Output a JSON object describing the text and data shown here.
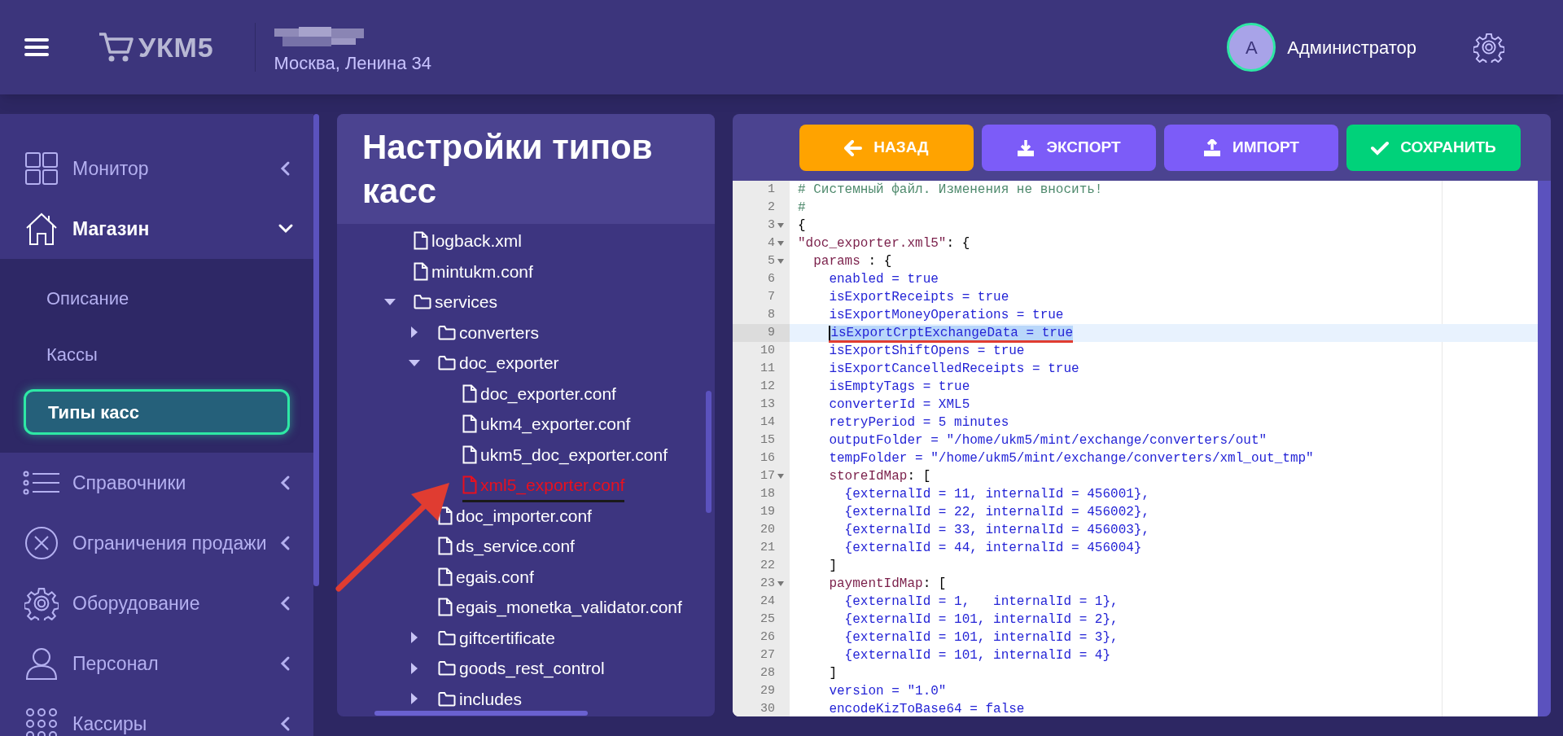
{
  "header": {
    "logo": "УКМ5",
    "address": "Москва, Ленина 34",
    "user": {
      "initial": "А",
      "name": "Администратор"
    }
  },
  "sidebar": {
    "items": [
      {
        "label": "Монитор",
        "expanded": false
      },
      {
        "label": "Магазин",
        "expanded": true,
        "children": [
          {
            "label": "Описание",
            "selected": false
          },
          {
            "label": "Кассы",
            "selected": false
          },
          {
            "label": "Типы касс",
            "selected": true
          }
        ]
      },
      {
        "label": "Справочники",
        "expanded": false
      },
      {
        "label": "Ограничения продажи",
        "expanded": false
      },
      {
        "label": "Оборудование",
        "expanded": false
      },
      {
        "label": "Персонал",
        "expanded": false
      },
      {
        "label": "Кассиры",
        "expanded": false
      }
    ]
  },
  "tree_panel": {
    "title": "Настройки типов касс",
    "tree": [
      {
        "name": "logback.xml",
        "kind": "file",
        "marked": false
      },
      {
        "name": "mintukm.conf",
        "kind": "file",
        "marked": false
      },
      {
        "name": "services",
        "kind": "folder",
        "expanded": true,
        "children": [
          {
            "name": "converters",
            "kind": "folder",
            "expanded": false
          },
          {
            "name": "doc_exporter",
            "kind": "folder",
            "expanded": true,
            "children": [
              {
                "name": "doc_exporter.conf",
                "kind": "file",
                "marked": false
              },
              {
                "name": "ukm4_exporter.conf",
                "kind": "file",
                "marked": false
              },
              {
                "name": "ukm5_doc_exporter.conf",
                "kind": "file",
                "marked": false
              },
              {
                "name": "xml5_exporter.conf",
                "kind": "file",
                "marked": true
              }
            ]
          },
          {
            "name": "doc_importer.conf",
            "kind": "file",
            "marked": false
          },
          {
            "name": "ds_service.conf",
            "kind": "file",
            "marked": false
          },
          {
            "name": "egais.conf",
            "kind": "file",
            "marked": false
          },
          {
            "name": "egais_monetka_validator.conf",
            "kind": "file",
            "marked": false
          },
          {
            "name": "giftcertificate",
            "kind": "folder",
            "expanded": false
          },
          {
            "name": "goods_rest_control",
            "kind": "folder",
            "expanded": false
          },
          {
            "name": "includes",
            "kind": "folder",
            "expanded": false
          }
        ]
      }
    ]
  },
  "editor": {
    "buttons": [
      {
        "label": "НАЗАД",
        "kind": "back"
      },
      {
        "label": "ЭКСПОРТ",
        "kind": "export"
      },
      {
        "label": "ИМПОРТ",
        "kind": "import"
      },
      {
        "label": "СОХРАНИТЬ",
        "kind": "save"
      }
    ],
    "lines": [
      {
        "number": "1",
        "foldable": false,
        "highlighted": false,
        "tokens": [
          {
            "text": "# Системный файл. Изменения не вносить!",
            "kind": "comment"
          }
        ]
      },
      {
        "number": "2",
        "foldable": false,
        "highlighted": false,
        "tokens": [
          {
            "text": "#",
            "kind": "comment"
          }
        ]
      },
      {
        "number": "3",
        "foldable": true,
        "highlighted": false,
        "tokens": [
          {
            "text": "{",
            "kind": "plain"
          }
        ]
      },
      {
        "number": "4",
        "foldable": true,
        "highlighted": false,
        "tokens": [
          {
            "text": "\"doc_exporter.xml5\"",
            "kind": "key"
          },
          {
            "text": ": {",
            "kind": "plain"
          }
        ]
      },
      {
        "number": "5",
        "foldable": true,
        "highlighted": false,
        "tokens": [
          {
            "text": "  params",
            "kind": "key"
          },
          {
            "text": " : {",
            "kind": "plain"
          }
        ]
      },
      {
        "number": "6",
        "foldable": false,
        "highlighted": false,
        "tokens": [
          {
            "text": "    enabled = true",
            "kind": "value"
          }
        ]
      },
      {
        "number": "7",
        "foldable": false,
        "highlighted": false,
        "tokens": [
          {
            "text": "    isExportReceipts = true",
            "kind": "value"
          }
        ]
      },
      {
        "number": "8",
        "foldable": false,
        "highlighted": false,
        "tokens": [
          {
            "text": "    isExportMoneyOperations = true",
            "kind": "value"
          }
        ]
      },
      {
        "number": "9",
        "foldable": false,
        "highlighted": true,
        "tokens": [
          {
            "text": "    isExportCrptExchangeData = true",
            "kind": "value"
          }
        ]
      },
      {
        "number": "10",
        "foldable": false,
        "highlighted": false,
        "tokens": [
          {
            "text": "    isExportShiftOpens = true",
            "kind": "value"
          }
        ]
      },
      {
        "number": "11",
        "foldable": false,
        "highlighted": false,
        "tokens": [
          {
            "text": "    isExportCancelledReceipts = true",
            "kind": "value"
          }
        ]
      },
      {
        "number": "12",
        "foldable": false,
        "highlighted": false,
        "tokens": [
          {
            "text": "    isEmptyTags = true",
            "kind": "value"
          }
        ]
      },
      {
        "number": "13",
        "foldable": false,
        "highlighted": false,
        "tokens": [
          {
            "text": "    converterId = XML5",
            "kind": "value"
          }
        ]
      },
      {
        "number": "14",
        "foldable": false,
        "highlighted": false,
        "tokens": [
          {
            "text": "    retryPeriod = 5 minutes",
            "kind": "value"
          }
        ]
      },
      {
        "number": "15",
        "foldable": false,
        "highlighted": false,
        "tokens": [
          {
            "text": "    outputFolder = \"/home/ukm5/mint/exchange/converters/out\"",
            "kind": "value"
          }
        ]
      },
      {
        "number": "16",
        "foldable": false,
        "highlighted": false,
        "tokens": [
          {
            "text": "    tempFolder = \"/home/ukm5/mint/exchange/converters/xml_out_tmp\"",
            "kind": "value"
          }
        ]
      },
      {
        "number": "17",
        "foldable": true,
        "highlighted": false,
        "tokens": [
          {
            "text": "    storeIdMap",
            "kind": "key"
          },
          {
            "text": ": [",
            "kind": "plain"
          }
        ]
      },
      {
        "number": "18",
        "foldable": false,
        "highlighted": false,
        "tokens": [
          {
            "text": "      {externalId = 11, internalId = 456001},",
            "kind": "value"
          }
        ]
      },
      {
        "number": "19",
        "foldable": false,
        "highlighted": false,
        "tokens": [
          {
            "text": "      {externalId = 22, internalId = 456002},",
            "kind": "value"
          }
        ]
      },
      {
        "number": "20",
        "foldable": false,
        "highlighted": false,
        "tokens": [
          {
            "text": "      {externalId = 33, internalId = 456003},",
            "kind": "value"
          }
        ]
      },
      {
        "number": "21",
        "foldable": false,
        "highlighted": false,
        "tokens": [
          {
            "text": "      {externalId = 44, internalId = 456004}",
            "kind": "value"
          }
        ]
      },
      {
        "number": "22",
        "foldable": false,
        "highlighted": false,
        "tokens": [
          {
            "text": "    ]",
            "kind": "plain"
          }
        ]
      },
      {
        "number": "23",
        "foldable": true,
        "highlighted": false,
        "tokens": [
          {
            "text": "    paymentIdMap",
            "kind": "key"
          },
          {
            "text": ": [",
            "kind": "plain"
          }
        ]
      },
      {
        "number": "24",
        "foldable": false,
        "highlighted": false,
        "tokens": [
          {
            "text": "      {externalId = 1,   internalId = 1},",
            "kind": "value"
          }
        ]
      },
      {
        "number": "25",
        "foldable": false,
        "highlighted": false,
        "tokens": [
          {
            "text": "      {externalId = 101, internalId = 2},",
            "kind": "value"
          }
        ]
      },
      {
        "number": "26",
        "foldable": false,
        "highlighted": false,
        "tokens": [
          {
            "text": "      {externalId = 101, internalId = 3},",
            "kind": "value"
          }
        ]
      },
      {
        "number": "27",
        "foldable": false,
        "highlighted": false,
        "tokens": [
          {
            "text": "      {externalId = 101, internalId = 4}",
            "kind": "value"
          }
        ]
      },
      {
        "number": "28",
        "foldable": false,
        "highlighted": false,
        "tokens": [
          {
            "text": "    ]",
            "kind": "plain"
          }
        ]
      },
      {
        "number": "29",
        "foldable": false,
        "highlighted": false,
        "tokens": [
          {
            "text": "    version = \"1.0\"",
            "kind": "value"
          }
        ]
      },
      {
        "number": "30",
        "foldable": false,
        "highlighted": false,
        "tokens": [
          {
            "text": "    encodeKizToBase64 = false",
            "kind": "value"
          }
        ]
      }
    ]
  }
}
